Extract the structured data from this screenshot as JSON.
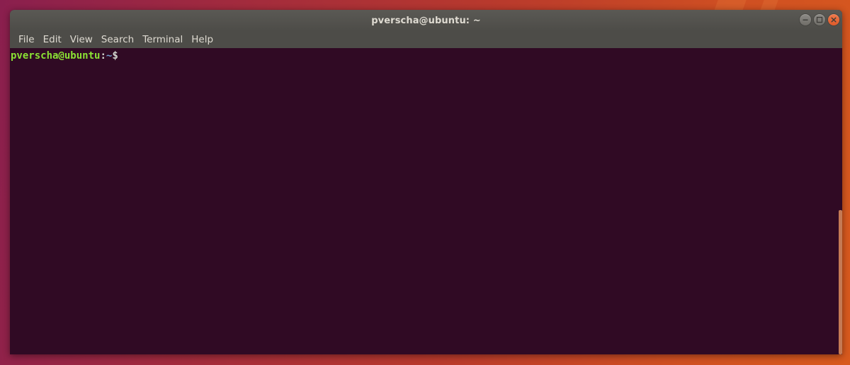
{
  "window": {
    "title": "pverscha@ubuntu: ~",
    "controls": [
      {
        "name": "minimize-button",
        "icon": "minimize-icon"
      },
      {
        "name": "maximize-button",
        "icon": "maximize-icon"
      },
      {
        "name": "close-button",
        "icon": "close-icon"
      }
    ]
  },
  "menu": {
    "items": [
      "File",
      "Edit",
      "View",
      "Search",
      "Terminal",
      "Help"
    ]
  },
  "terminal": {
    "prompt": {
      "user_host": "pverscha@ubuntu",
      "colon": ":",
      "path": "~",
      "symbol": "$"
    },
    "scroll_position": {
      "thumb_start_fraction": 0.53,
      "thumb_end_fraction": 1.0
    }
  },
  "colors": {
    "terminal_background": "#300a24",
    "prompt_user": "#8ae234",
    "prompt_path": "#729fcf",
    "titlebar": "#4d4c48",
    "close_button": "#e5652e",
    "scrollbar_thumb": "#c47a55"
  }
}
